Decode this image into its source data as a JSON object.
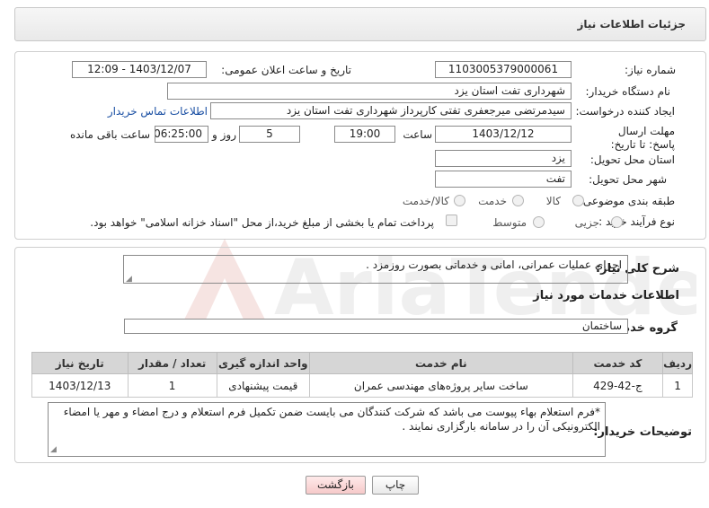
{
  "header": {
    "title": "جزئیات اطلاعات نیاز"
  },
  "form": {
    "need_number_label": "شماره نیاز:",
    "need_number": "1103005379000061",
    "announce_label": "تاریخ و ساعت اعلان عمومی:",
    "announce_value": "1403/12/07 - 12:09",
    "buyer_org_label": "نام دستگاه خریدار:",
    "buyer_org": "شهرداری تفت استان یزد",
    "creator_label": "ایجاد کننده درخواست:",
    "creator": "سیدمرتضی میرجعفری تفتی کارپرداز شهرداری تفت استان یزد",
    "buyer_contact_link": "اطلاعات تماس خریدار",
    "deadline_label": "مهلت ارسال پاسخ: تا تاریخ:",
    "deadline_date": "1403/12/12",
    "time_label": "ساعت",
    "deadline_time": "19:00",
    "days_value": "5",
    "days_label": "روز و",
    "remaining_time": "06:25:00",
    "remaining_label": "ساعت باقی مانده",
    "province_label": "استان محل تحویل:",
    "province": "یزد",
    "city_label": "شهر محل تحویل:",
    "city": "تفت",
    "category_label": "طبقه بندی موضوعی:",
    "category_options": [
      "کالا",
      "خدمت",
      "کالا/خدمت"
    ],
    "process_label": "نوع فرآیند خرید :",
    "process_options": [
      "جزیی",
      "متوسط"
    ],
    "payment_note": "پرداخت تمام یا بخشی از مبلغ خرید،از محل \"اسناد خزانه اسلامی\" خواهد بود."
  },
  "details": {
    "summary_label": "شرح کلی نیاز:",
    "summary": "اجرای عملیات عمرانی، امانی و خدماتی بصورت روزمزد .",
    "services_title": "اطلاعات خدمات مورد نیاز",
    "service_group_label": "گروه خدمت:",
    "service_group": "ساختمان",
    "table": {
      "headers": [
        "ردیف",
        "کد خدمت",
        "نام خدمت",
        "واحد اندازه گیری",
        "تعداد / مقدار",
        "تاریخ نیاز"
      ],
      "rows": [
        [
          "1",
          "ج-42-429",
          "ساخت سایر پروژه‌های مهندسی عمران",
          "قیمت پیشنهادی",
          "1",
          "1403/12/13"
        ]
      ]
    },
    "buyer_notes_label": "توضیحات خریدار:",
    "buyer_notes": "*فرم استعلام بهاء پیوست می باشد که شرکت کنندگان می بایست ضمن تکمیل فرم استعلام و درج امضاء و مهر یا امضاء الکترونیکی آن را در سامانه بارگزاری نمایند ."
  },
  "buttons": {
    "print": "چاپ",
    "back": "بازگشت"
  },
  "watermark": {
    "text": "AriaTender.neT"
  },
  "colors": {
    "link": "#1a4fa3",
    "watermark": "#c0392b",
    "back_button": "#f6c9c9"
  }
}
